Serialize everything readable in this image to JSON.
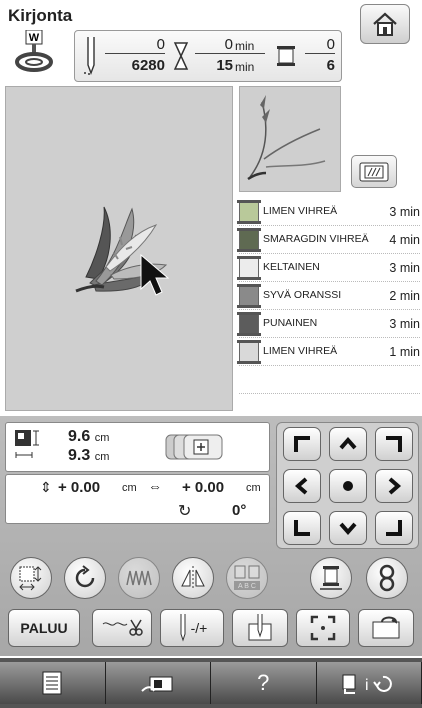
{
  "screen": {
    "title": "Kirjonta"
  },
  "status": {
    "stitches_done": "0",
    "stitches_total": "6280",
    "time_done": "0",
    "time_total": "15",
    "time_unit": "min",
    "colors_done": "0",
    "colors_total": "6"
  },
  "colors": [
    {
      "name": "LIMEN VIHREÄ",
      "time": "3 min",
      "hex": "#b9c99a"
    },
    {
      "name": "SMARAGDIN VIHREÄ",
      "time": "4 min",
      "hex": "#5f6a52"
    },
    {
      "name": "KELTAINEN",
      "time": "3 min",
      "hex": "#ececec"
    },
    {
      "name": "SYVÄ ORANSSI",
      "time": "2 min",
      "hex": "#8a8a8a"
    },
    {
      "name": "PUNAINEN",
      "time": "3 min",
      "hex": "#5c5c5c"
    },
    {
      "name": "LIMEN VIHREÄ",
      "time": "1 min",
      "hex": "#d9d9d9"
    }
  ],
  "size": {
    "height": "9.6",
    "width": "9.3",
    "unit": "cm"
  },
  "offset": {
    "v": "+ 0.00",
    "h": "+ 0.00",
    "unit": "cm",
    "angle": "0°"
  },
  "buttons": {
    "back": "PALUU",
    "thread_tension": "-/+"
  },
  "bottom_bar": {
    "help": "?"
  }
}
